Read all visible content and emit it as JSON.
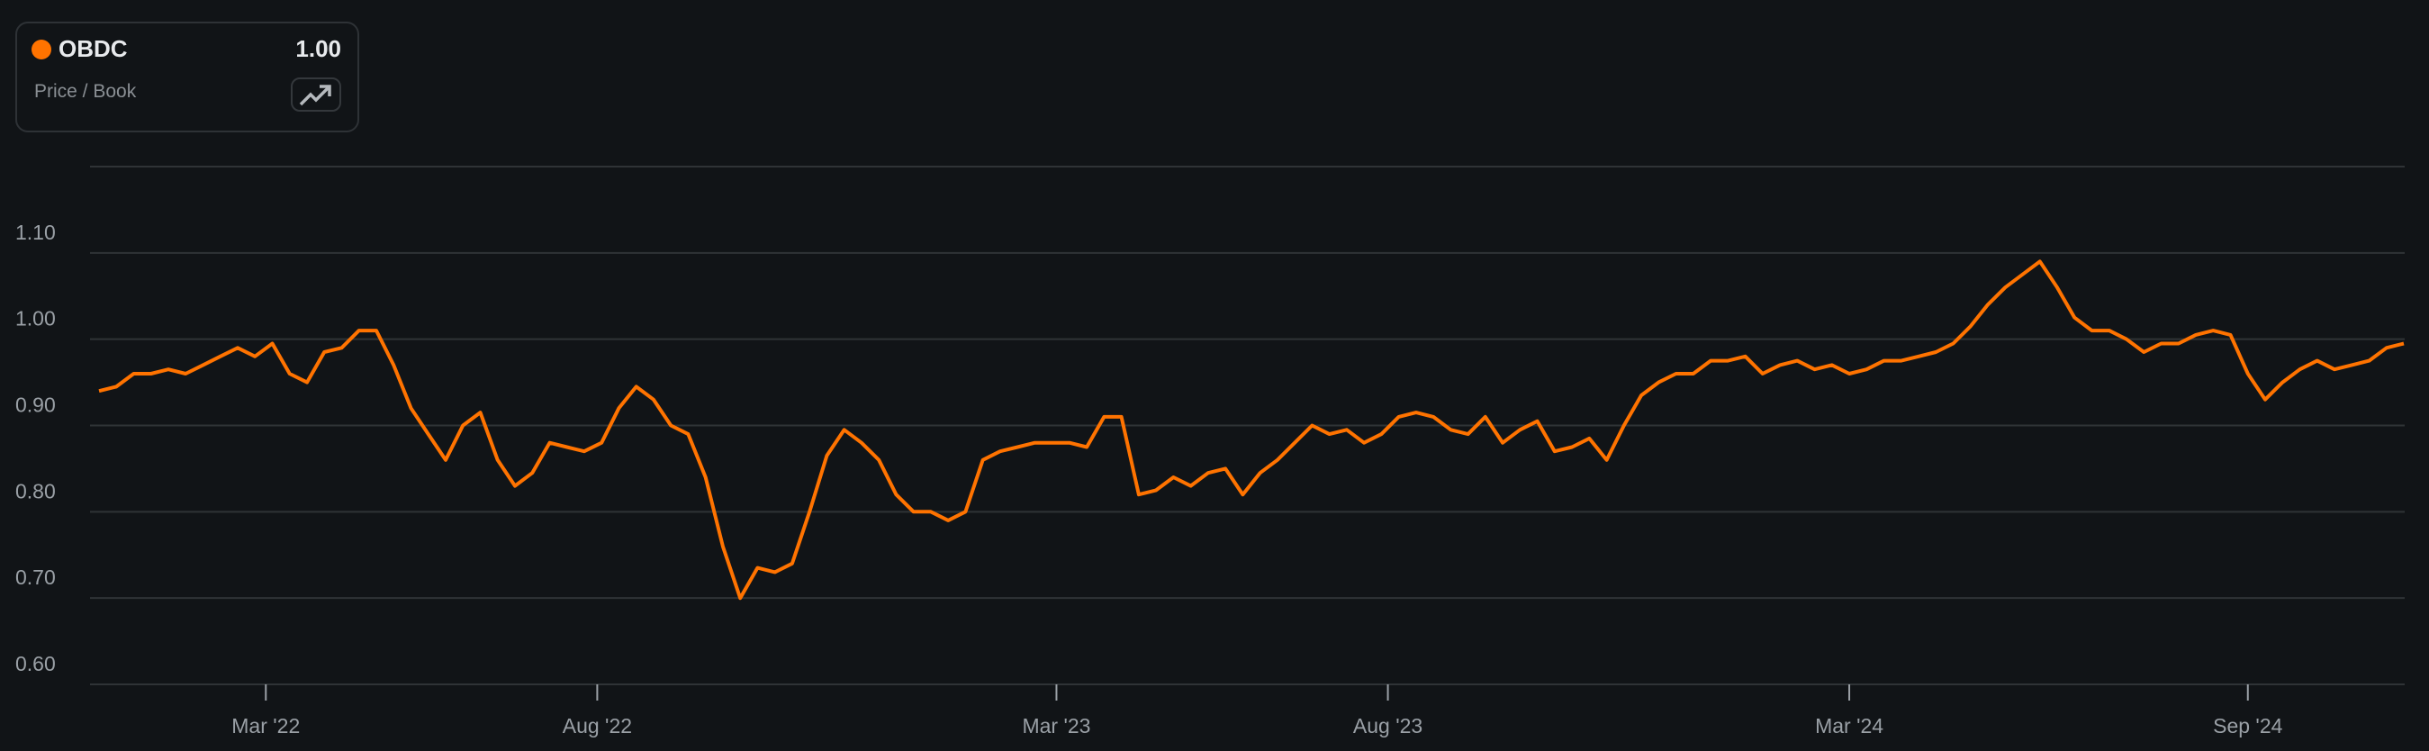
{
  "legend": {
    "ticker": "OBDC",
    "value": "1.00",
    "metric": "Price / Book",
    "icon": "trending-up-icon",
    "series_color": "#ff7300"
  },
  "chart_data": {
    "type": "line",
    "title": "",
    "xlabel": "",
    "ylabel": "Price / Book",
    "series": [
      {
        "name": "OBDC",
        "color": "#ff7300",
        "start_date": "2021-12-14",
        "end_date": "2024-11-12",
        "values": [
          0.94,
          0.945,
          0.96,
          0.96,
          0.965,
          0.96,
          0.97,
          0.98,
          0.99,
          0.98,
          0.995,
          0.96,
          0.95,
          0.985,
          0.99,
          1.01,
          1.01,
          0.97,
          0.92,
          0.89,
          0.86,
          0.9,
          0.915,
          0.86,
          0.83,
          0.845,
          0.88,
          0.875,
          0.87,
          0.88,
          0.92,
          0.945,
          0.93,
          0.9,
          0.89,
          0.84,
          0.76,
          0.7,
          0.735,
          0.73,
          0.74,
          0.8,
          0.865,
          0.895,
          0.88,
          0.86,
          0.82,
          0.8,
          0.8,
          0.79,
          0.8,
          0.86,
          0.87,
          0.875,
          0.88,
          0.88,
          0.88,
          0.875,
          0.91,
          0.91,
          0.82,
          0.825,
          0.84,
          0.83,
          0.845,
          0.85,
          0.82,
          0.845,
          0.86,
          0.88,
          0.9,
          0.89,
          0.895,
          0.88,
          0.89,
          0.91,
          0.915,
          0.91,
          0.895,
          0.89,
          0.91,
          0.88,
          0.895,
          0.905,
          0.87,
          0.875,
          0.885,
          0.86,
          0.9,
          0.935,
          0.95,
          0.96,
          0.96,
          0.975,
          0.975,
          0.98,
          0.96,
          0.97,
          0.975,
          0.965,
          0.97,
          0.96,
          0.965,
          0.975,
          0.975,
          0.98,
          0.985,
          0.995,
          1.015,
          1.04,
          1.06,
          1.075,
          1.09,
          1.06,
          1.025,
          1.01,
          1.01,
          1.0,
          0.985,
          0.995,
          0.995,
          1.005,
          1.01,
          1.005,
          0.96,
          0.93,
          0.95,
          0.965,
          0.975,
          0.965,
          0.97,
          0.975,
          0.99,
          0.995
        ]
      }
    ],
    "yticks": [
      "0.60",
      "0.70",
      "0.80",
      "0.90",
      "1.00",
      "1.10"
    ],
    "ylim": [
      0.6,
      1.2
    ],
    "xticks": [
      {
        "label": "Mar '22",
        "date": "2022-03-01"
      },
      {
        "label": "Aug '22",
        "date": "2022-08-01"
      },
      {
        "label": "Mar '23",
        "date": "2023-03-01"
      },
      {
        "label": "Aug '23",
        "date": "2023-08-01"
      },
      {
        "label": "Mar '24",
        "date": "2024-03-01"
      },
      {
        "label": "Sep '24",
        "date": "2024-09-01"
      }
    ],
    "grid": true,
    "legend_position": "top-left"
  }
}
